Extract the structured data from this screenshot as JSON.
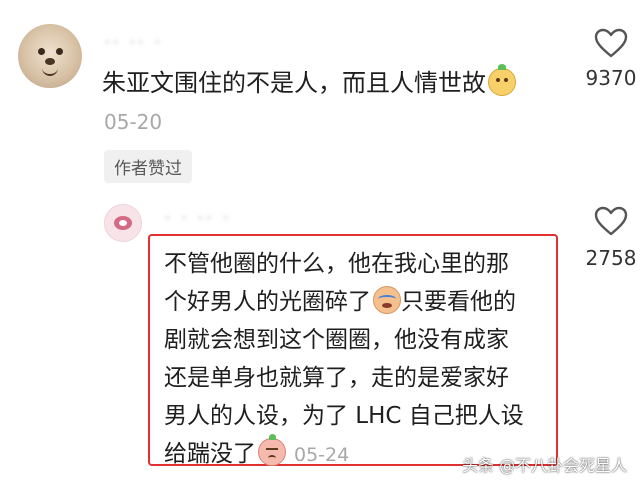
{
  "comments": [
    {
      "username_blurred": "·· ·· ·",
      "text": "朱亚文围住的不是人，而且人情世故",
      "emoji": "smiling-face-emoji",
      "date": "05-20",
      "badge": "作者赞过",
      "likes": "9370"
    },
    {
      "username_blurred": "· · ·· ·",
      "lines": [
        "不管他圈的什么，他在我心里的那",
        "个好男人的光圈碎了",
        "只要看他的",
        "剧就会想到这个圈圈，他没有成家",
        "还是单身也就算了，走的是爱家好",
        "男人的人设，为了 LHC 自己把人设",
        "给踹没了"
      ],
      "date": "05-24",
      "likes": "2758"
    }
  ],
  "watermark": "头条 @不八卦会死星人",
  "colors": {
    "highlight": "#e0302f",
    "muted": "#a8a8a8",
    "text": "#1f1f1f"
  }
}
